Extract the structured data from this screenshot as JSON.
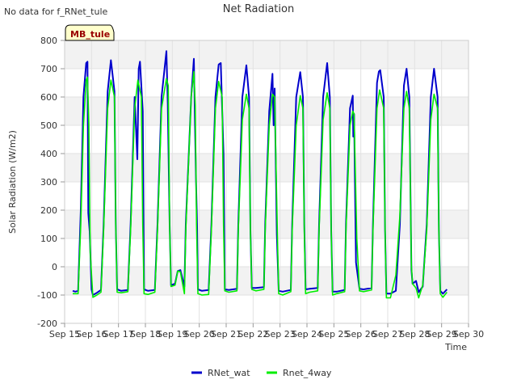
{
  "note": "No data for f_RNet_tule",
  "badge": "MB_tule",
  "chart_data": {
    "type": "line",
    "title": "Net Radiation",
    "xlabel": "Time",
    "ylabel": "Solar Radiation (W/m2)",
    "xlim": [
      15,
      30
    ],
    "ylim": [
      -200,
      800
    ],
    "x_ticks": [
      {
        "v": 15,
        "label": "Sep 15"
      },
      {
        "v": 16,
        "label": "Sep 16"
      },
      {
        "v": 17,
        "label": "Sep 17"
      },
      {
        "v": 18,
        "label": "Sep 18"
      },
      {
        "v": 19,
        "label": "Sep 19"
      },
      {
        "v": 20,
        "label": "Sep 20"
      },
      {
        "v": 21,
        "label": "Sep 21"
      },
      {
        "v": 22,
        "label": "Sep 22"
      },
      {
        "v": 23,
        "label": "Sep 23"
      },
      {
        "v": 24,
        "label": "Sep 24"
      },
      {
        "v": 25,
        "label": "Sep 25"
      },
      {
        "v": 26,
        "label": "Sep 26"
      },
      {
        "v": 27,
        "label": "Sep 27"
      },
      {
        "v": 28,
        "label": "Sep 28"
      },
      {
        "v": 29,
        "label": "Sep 29"
      },
      {
        "v": 30,
        "label": "Sep 30"
      }
    ],
    "y_ticks": [
      -200,
      -100,
      0,
      100,
      200,
      300,
      400,
      500,
      600,
      700,
      800
    ],
    "grid": true,
    "legend_position": "bottom-center",
    "series": [
      {
        "name": "RNet_wat",
        "color": "#0000cc",
        "points": [
          [
            15.3,
            -85
          ],
          [
            15.4,
            -88
          ],
          [
            15.5,
            -85
          ],
          [
            15.6,
            200
          ],
          [
            15.7,
            600
          ],
          [
            15.8,
            720
          ],
          [
            15.85,
            725
          ],
          [
            15.88,
            190
          ],
          [
            15.93,
            125
          ],
          [
            16.0,
            -80
          ],
          [
            16.05,
            -100
          ],
          [
            16.2,
            -92
          ],
          [
            16.35,
            -82
          ],
          [
            16.45,
            150
          ],
          [
            16.6,
            620
          ],
          [
            16.72,
            730
          ],
          [
            16.85,
            620
          ],
          [
            16.9,
            150
          ],
          [
            16.95,
            -80
          ],
          [
            17.1,
            -85
          ],
          [
            17.35,
            -82
          ],
          [
            17.45,
            150
          ],
          [
            17.6,
            600
          ],
          [
            17.7,
            380
          ],
          [
            17.75,
            700
          ],
          [
            17.8,
            725
          ],
          [
            17.9,
            550
          ],
          [
            17.95,
            -80
          ],
          [
            18.1,
            -85
          ],
          [
            18.35,
            -82
          ],
          [
            18.45,
            150
          ],
          [
            18.6,
            600
          ],
          [
            18.78,
            762
          ],
          [
            18.83,
            575
          ],
          [
            18.9,
            150
          ],
          [
            18.95,
            -65
          ],
          [
            19.1,
            -60
          ],
          [
            19.2,
            -15
          ],
          [
            19.3,
            -12
          ],
          [
            19.45,
            -70
          ],
          [
            19.5,
            150
          ],
          [
            19.7,
            600
          ],
          [
            19.8,
            735
          ],
          [
            19.85,
            455
          ],
          [
            19.88,
            300
          ],
          [
            19.92,
            140
          ],
          [
            19.95,
            -80
          ],
          [
            20.1,
            -85
          ],
          [
            20.35,
            -82
          ],
          [
            20.45,
            150
          ],
          [
            20.6,
            600
          ],
          [
            20.72,
            715
          ],
          [
            20.8,
            720
          ],
          [
            20.9,
            400
          ],
          [
            20.95,
            -80
          ],
          [
            21.1,
            -82
          ],
          [
            21.4,
            -78
          ],
          [
            21.45,
            150
          ],
          [
            21.6,
            600
          ],
          [
            21.75,
            712
          ],
          [
            21.85,
            600
          ],
          [
            21.9,
            130
          ],
          [
            21.95,
            -75
          ],
          [
            22.1,
            -75
          ],
          [
            22.4,
            -72
          ],
          [
            22.45,
            150
          ],
          [
            22.6,
            550
          ],
          [
            22.72,
            682
          ],
          [
            22.76,
            500
          ],
          [
            22.8,
            630
          ],
          [
            22.88,
            115
          ],
          [
            22.95,
            -85
          ],
          [
            23.1,
            -88
          ],
          [
            23.4,
            -82
          ],
          [
            23.45,
            150
          ],
          [
            23.6,
            600
          ],
          [
            23.75,
            688
          ],
          [
            23.85,
            600
          ],
          [
            23.9,
            150
          ],
          [
            23.95,
            -80
          ],
          [
            24.1,
            -78
          ],
          [
            24.4,
            -75
          ],
          [
            24.45,
            150
          ],
          [
            24.6,
            600
          ],
          [
            24.75,
            720
          ],
          [
            24.85,
            600
          ],
          [
            24.9,
            130
          ],
          [
            24.95,
            -88
          ],
          [
            25.1,
            -88
          ],
          [
            25.4,
            -82
          ],
          [
            25.45,
            150
          ],
          [
            25.6,
            560
          ],
          [
            25.7,
            605
          ],
          [
            25.72,
            460
          ],
          [
            25.75,
            540
          ],
          [
            25.82,
            15
          ],
          [
            25.95,
            -78
          ],
          [
            26.1,
            -80
          ],
          [
            26.4,
            -75
          ],
          [
            26.45,
            150
          ],
          [
            26.6,
            650
          ],
          [
            26.67,
            690
          ],
          [
            26.72,
            695
          ],
          [
            26.85,
            600
          ],
          [
            26.9,
            130
          ],
          [
            26.95,
            -95
          ],
          [
            27.1,
            -95
          ],
          [
            27.3,
            -85
          ],
          [
            27.45,
            150
          ],
          [
            27.6,
            640
          ],
          [
            27.7,
            700
          ],
          [
            27.8,
            600
          ],
          [
            27.88,
            -10
          ],
          [
            27.92,
            -60
          ],
          [
            28.05,
            -50
          ],
          [
            28.15,
            -90
          ],
          [
            28.3,
            -70
          ],
          [
            28.45,
            150
          ],
          [
            28.6,
            600
          ],
          [
            28.72,
            700
          ],
          [
            28.85,
            600
          ],
          [
            28.9,
            130
          ],
          [
            28.95,
            -85
          ],
          [
            29.05,
            -95
          ],
          [
            29.2,
            -80
          ]
        ]
      },
      {
        "name": "Rnet_4way",
        "color": "#00ee00",
        "points": [
          [
            15.3,
            -95
          ],
          [
            15.5,
            -95
          ],
          [
            15.6,
            150
          ],
          [
            15.7,
            500
          ],
          [
            15.8,
            660
          ],
          [
            15.85,
            670
          ],
          [
            15.9,
            500
          ],
          [
            15.95,
            50
          ],
          [
            16.05,
            -108
          ],
          [
            16.2,
            -100
          ],
          [
            16.35,
            -90
          ],
          [
            16.45,
            130
          ],
          [
            16.6,
            560
          ],
          [
            16.72,
            660
          ],
          [
            16.85,
            600
          ],
          [
            16.9,
            150
          ],
          [
            16.95,
            -90
          ],
          [
            17.1,
            -92
          ],
          [
            17.35,
            -88
          ],
          [
            17.45,
            130
          ],
          [
            17.6,
            560
          ],
          [
            17.72,
            660
          ],
          [
            17.85,
            600
          ],
          [
            17.9,
            150
          ],
          [
            17.95,
            -95
          ],
          [
            18.1,
            -98
          ],
          [
            18.35,
            -90
          ],
          [
            18.45,
            130
          ],
          [
            18.6,
            560
          ],
          [
            18.78,
            665
          ],
          [
            18.85,
            640
          ],
          [
            18.9,
            150
          ],
          [
            18.95,
            -70
          ],
          [
            19.1,
            -65
          ],
          [
            19.2,
            -15
          ],
          [
            19.3,
            -18
          ],
          [
            19.45,
            -95
          ],
          [
            19.5,
            130
          ],
          [
            19.7,
            600
          ],
          [
            19.8,
            690
          ],
          [
            19.85,
            570
          ],
          [
            19.9,
            150
          ],
          [
            19.95,
            -95
          ],
          [
            20.1,
            -100
          ],
          [
            20.35,
            -98
          ],
          [
            20.45,
            130
          ],
          [
            20.6,
            560
          ],
          [
            20.72,
            655
          ],
          [
            20.85,
            600
          ],
          [
            20.9,
            150
          ],
          [
            20.95,
            -85
          ],
          [
            21.1,
            -90
          ],
          [
            21.4,
            -85
          ],
          [
            21.45,
            130
          ],
          [
            21.6,
            520
          ],
          [
            21.75,
            610
          ],
          [
            21.85,
            560
          ],
          [
            21.9,
            130
          ],
          [
            21.95,
            -80
          ],
          [
            22.1,
            -85
          ],
          [
            22.4,
            -80
          ],
          [
            22.45,
            130
          ],
          [
            22.6,
            500
          ],
          [
            22.72,
            610
          ],
          [
            22.8,
            600
          ],
          [
            22.9,
            130
          ],
          [
            22.95,
            -95
          ],
          [
            23.1,
            -100
          ],
          [
            23.4,
            -88
          ],
          [
            23.45,
            130
          ],
          [
            23.6,
            500
          ],
          [
            23.75,
            605
          ],
          [
            23.85,
            560
          ],
          [
            23.9,
            130
          ],
          [
            23.95,
            -95
          ],
          [
            24.1,
            -90
          ],
          [
            24.4,
            -85
          ],
          [
            24.45,
            130
          ],
          [
            24.6,
            520
          ],
          [
            24.75,
            615
          ],
          [
            24.85,
            560
          ],
          [
            24.9,
            130
          ],
          [
            24.95,
            -100
          ],
          [
            25.1,
            -95
          ],
          [
            25.4,
            -88
          ],
          [
            25.45,
            130
          ],
          [
            25.6,
            500
          ],
          [
            25.7,
            550
          ],
          [
            25.75,
            540
          ],
          [
            25.85,
            100
          ],
          [
            25.95,
            -85
          ],
          [
            26.1,
            -88
          ],
          [
            26.4,
            -82
          ],
          [
            26.45,
            130
          ],
          [
            26.6,
            560
          ],
          [
            26.7,
            625
          ],
          [
            26.85,
            560
          ],
          [
            26.9,
            130
          ],
          [
            26.95,
            -110
          ],
          [
            27.1,
            -110
          ],
          [
            27.3,
            -30
          ],
          [
            27.45,
            180
          ],
          [
            27.6,
            560
          ],
          [
            27.7,
            620
          ],
          [
            27.8,
            560
          ],
          [
            27.88,
            0
          ],
          [
            27.92,
            -60
          ],
          [
            28.05,
            -75
          ],
          [
            28.15,
            -110
          ],
          [
            28.3,
            -65
          ],
          [
            28.45,
            130
          ],
          [
            28.6,
            520
          ],
          [
            28.72,
            610
          ],
          [
            28.85,
            560
          ],
          [
            28.9,
            130
          ],
          [
            28.95,
            -95
          ],
          [
            29.05,
            -108
          ],
          [
            29.2,
            -90
          ]
        ]
      }
    ]
  }
}
